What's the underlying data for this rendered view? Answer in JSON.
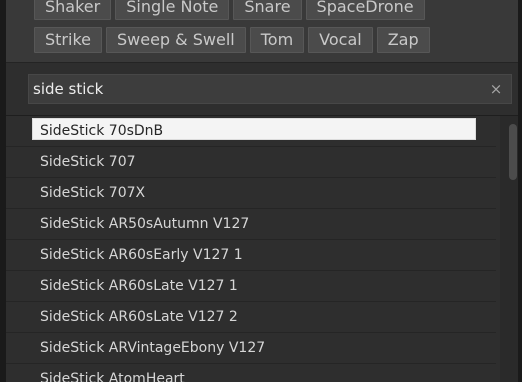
{
  "tags": {
    "row1": [
      "Shaker",
      "Single Note",
      "Snare",
      "SpaceDrone"
    ],
    "row2": [
      "Strike",
      "Sweep & Swell",
      "Tom",
      "Vocal",
      "Zap"
    ]
  },
  "search": {
    "value": "side stick",
    "clear_glyph": "×"
  },
  "results": [
    "SideStick 70sDnB",
    "SideStick 707",
    "SideStick 707X",
    "SideStick AR50sAutumn V127",
    "SideStick AR60sEarly V127 1",
    "SideStick AR60sLate V127 1",
    "SideStick AR60sLate V127 2",
    "SideStick ARVintageEbony V127",
    "SideStick AtomHeart"
  ],
  "selected_index": 0,
  "icons": {
    "clear": "close-icon"
  },
  "colors": {
    "background": "#2e2e2e",
    "tag_bg": "#4b4b4b",
    "selection": "#f4f4f4"
  }
}
